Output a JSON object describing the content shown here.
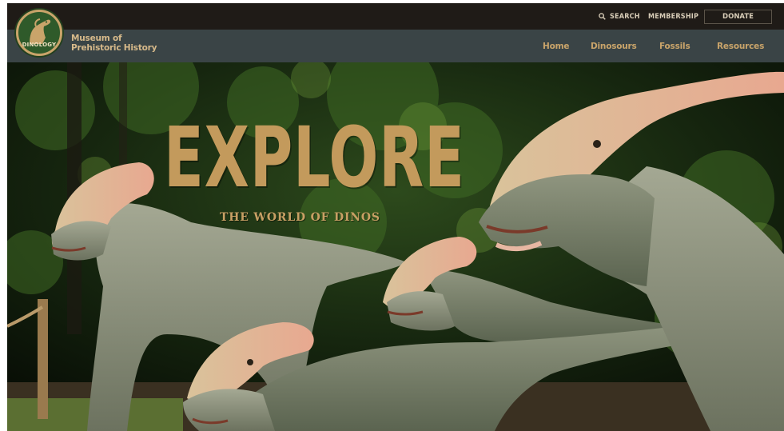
{
  "utility": {
    "search_label": "SEARCH",
    "membership_label": "MEMBERSHIP",
    "donate_label": "DONATE"
  },
  "brand": {
    "logo_text": "DINOLOGY",
    "name_line1": "Museum of",
    "name_line2": "Prehistoric History"
  },
  "nav": {
    "items": [
      {
        "label": "Home"
      },
      {
        "label": "Dinosours"
      },
      {
        "label": "Fossils"
      },
      {
        "label": "Resources"
      }
    ]
  },
  "hero": {
    "headline": "EXPLORE",
    "subheadline": "THE WORLD OF DINOS"
  },
  "icons": {
    "search": "search-icon",
    "logo": "dinosaur-logo-icon"
  },
  "colors": {
    "topbar": "#1f1b17",
    "navbar": "#3a4446",
    "accent": "#c39a5c",
    "nav_text": "#c9a46a"
  }
}
